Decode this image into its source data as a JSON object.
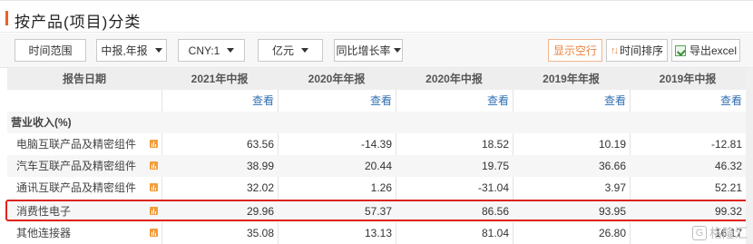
{
  "page": {
    "title": "按产品(项目)分类"
  },
  "toolbar": {
    "time_range": "时间范围",
    "report_type": "中报,年报",
    "currency": "CNY:1",
    "unit": "亿元",
    "growth": "同比增长率",
    "show_empty": "显示空行",
    "time_sort": "时间排序",
    "export": "导出excel"
  },
  "table": {
    "header_label": "报告日期",
    "columns": [
      "2021年中报",
      "2020年年报",
      "2020年中报",
      "2019年年报",
      "2019年中报"
    ],
    "view_link": "查看",
    "section": "营业收入(%)",
    "rows": [
      {
        "label": "电脑互联产品及精密组件",
        "values": [
          "63.56",
          "-14.39",
          "18.52",
          "10.19",
          "-12.81"
        ]
      },
      {
        "label": "汽车互联产品及精密组件",
        "values": [
          "38.99",
          "20.44",
          "19.75",
          "36.66",
          "46.32"
        ]
      },
      {
        "label": "通讯互联产品及精密组件",
        "values": [
          "32.02",
          "1.26",
          "-31.04",
          "3.97",
          "52.21"
        ]
      },
      {
        "label": "消费性电子",
        "values": [
          "29.96",
          "57.37",
          "86.56",
          "93.95",
          "99.32"
        ]
      },
      {
        "label": "其他连接器",
        "values": [
          "35.08",
          "13.13",
          "81.04",
          "26.80",
          "16.17"
        ]
      }
    ]
  },
  "highlight_row_index": 3,
  "watermark": {
    "badge": "G",
    "text": "格隆汇"
  },
  "colors": {
    "accent": "#e8612b",
    "link": "#2f6fb3",
    "highlight_border": "#e0231b",
    "chart_icon": "#f39d3b"
  }
}
